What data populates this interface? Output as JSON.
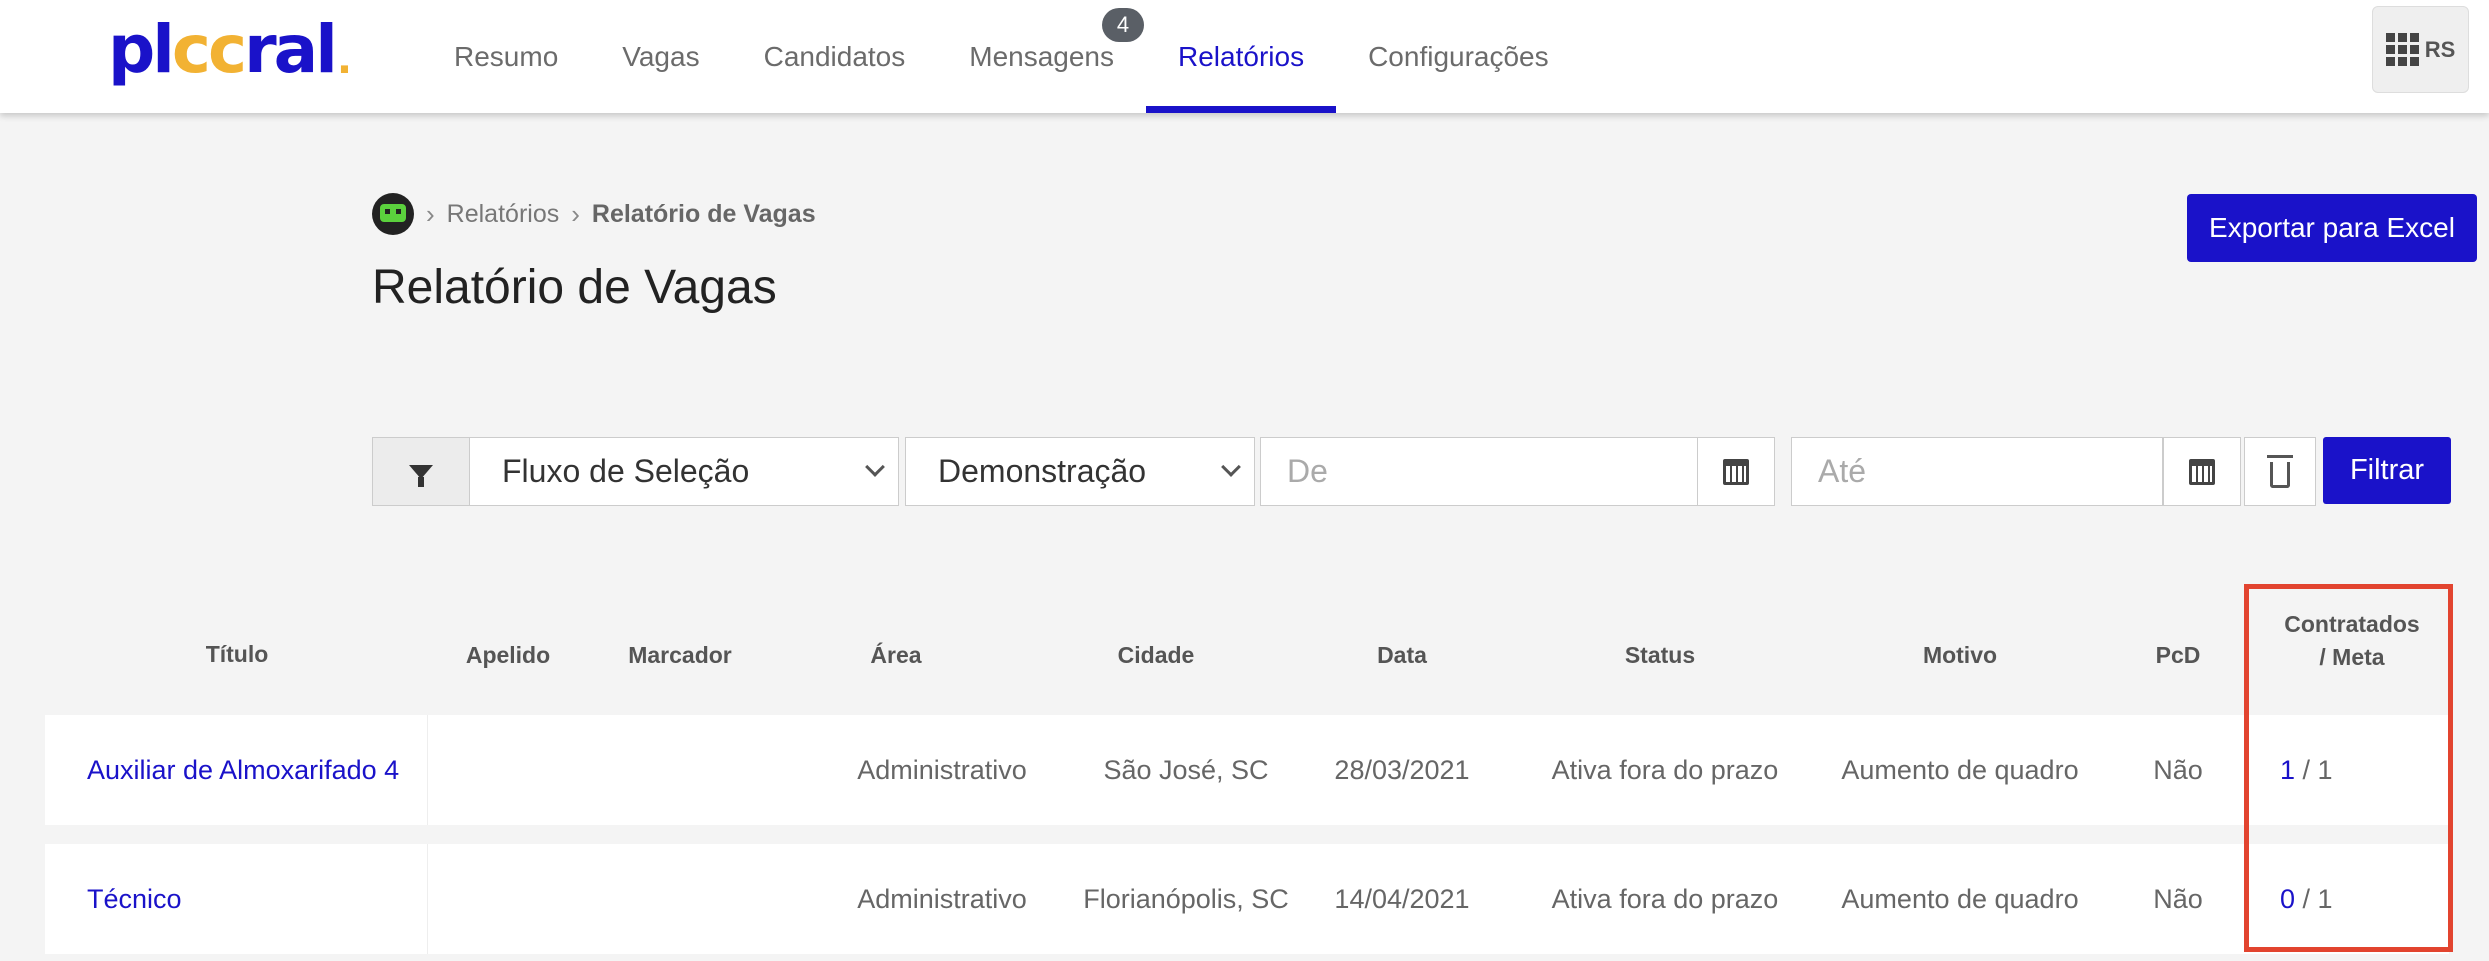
{
  "brand": {
    "logo_pre": "pl",
    "logo_mark": "cc",
    "logo_post": "ral",
    "logo_dot": "."
  },
  "nav": {
    "items": [
      {
        "label": "Resumo"
      },
      {
        "label": "Vagas"
      },
      {
        "label": "Candidatos"
      },
      {
        "label": "Mensagens",
        "badge": "4"
      },
      {
        "label": "Relatórios",
        "active": true
      },
      {
        "label": "Configurações"
      }
    ],
    "user_initials": "RS"
  },
  "breadcrumb": {
    "section": "Relatórios",
    "current": "Relatório de Vagas"
  },
  "page": {
    "title": "Relatório de Vagas",
    "export_label": "Exportar para Excel"
  },
  "filters": {
    "flow_select": "Fluxo de Seleção",
    "scope_select": "Demonstração",
    "from_placeholder": "De",
    "to_placeholder": "Até",
    "filter_button": "Filtrar"
  },
  "table": {
    "columns": [
      "Título",
      "Apelido",
      "Marcador",
      "Área",
      "Cidade",
      "Data",
      "Status",
      "Motivo",
      "PcD"
    ],
    "last_column_line1": "Contratados",
    "last_column_line2": "/ Meta",
    "rows": [
      {
        "title": "Auxiliar de Almoxarifado 4",
        "apelido": "",
        "marcador": "",
        "area": "Administrativo",
        "cidade": "São José, SC",
        "data": "28/03/2021",
        "status": "Ativa fora do prazo",
        "motivo": "Aumento de quadro",
        "pcd": "Não",
        "contratados": "1",
        "meta": "/ 1"
      },
      {
        "title": "Técnico",
        "apelido": "",
        "marcador": "",
        "area": "Administrativo",
        "cidade": "Florianópolis, SC",
        "data": "14/04/2021",
        "status": "Ativa fora do prazo",
        "motivo": "Aumento de quadro",
        "pcd": "Não",
        "contratados": "0",
        "meta": "/ 1"
      }
    ]
  },
  "colors": {
    "brand_blue": "#1a12c9",
    "brand_yellow": "#f2b233",
    "highlight_red": "#e2442f"
  }
}
